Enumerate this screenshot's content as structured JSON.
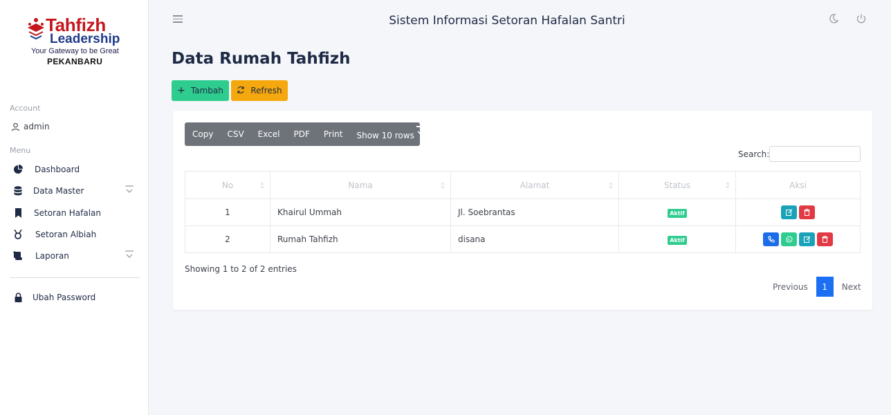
{
  "brand": {
    "title": "Tahfizh",
    "subtitle": "Leadership",
    "tagline": "Your Gateway to be Great",
    "city": "PEKANBARU"
  },
  "sidebar": {
    "account_label": "Account",
    "username": "admin",
    "menu_label": "Menu",
    "items": [
      {
        "label": "Dashboard",
        "icon": "pie-chart-icon"
      },
      {
        "label": "Data Master",
        "icon": "database-icon"
      },
      {
        "label": "Setoran Hafalan",
        "icon": "bookmark-icon"
      },
      {
        "label": "Setoran Albiah",
        "icon": "medal-icon"
      },
      {
        "label": "Laporan",
        "icon": "scroll-icon"
      }
    ],
    "password_label": "Ubah Password"
  },
  "header": {
    "title": "Sistem Informasi Setoran Hafalan Santri"
  },
  "page": {
    "title": "Data Rumah Tahfizh",
    "add_label": "Tambah",
    "refresh_label": "Refresh"
  },
  "toolbar": {
    "copy": "Copy",
    "csv": "CSV",
    "excel": "Excel",
    "pdf": "PDF",
    "print": "Print",
    "rows": "Show 10 rows"
  },
  "search": {
    "label": "Search:",
    "value": ""
  },
  "table": {
    "columns": [
      "No",
      "Nama",
      "Alamat",
      "Status",
      "Aksi"
    ],
    "rows": [
      {
        "no": "1",
        "nama": "Khairul Ummah",
        "alamat": "Jl. Soebrantas",
        "status": "Aktif"
      },
      {
        "no": "2",
        "nama": "Rumah Tahfizh",
        "alamat": "disana",
        "status": "Aktif"
      }
    ]
  },
  "footer": {
    "info": "Showing 1 to 2 of 2 entries",
    "previous": "Previous",
    "page": "1",
    "next": "Next"
  },
  "colors": {
    "primary": "#1c6ef2",
    "success": "#2ecc8f",
    "warning": "#f4a80d",
    "danger": "#e23a45",
    "info": "#1aa3b8",
    "brand_red": "#c4161c",
    "brand_blue": "#1f3a8a"
  }
}
